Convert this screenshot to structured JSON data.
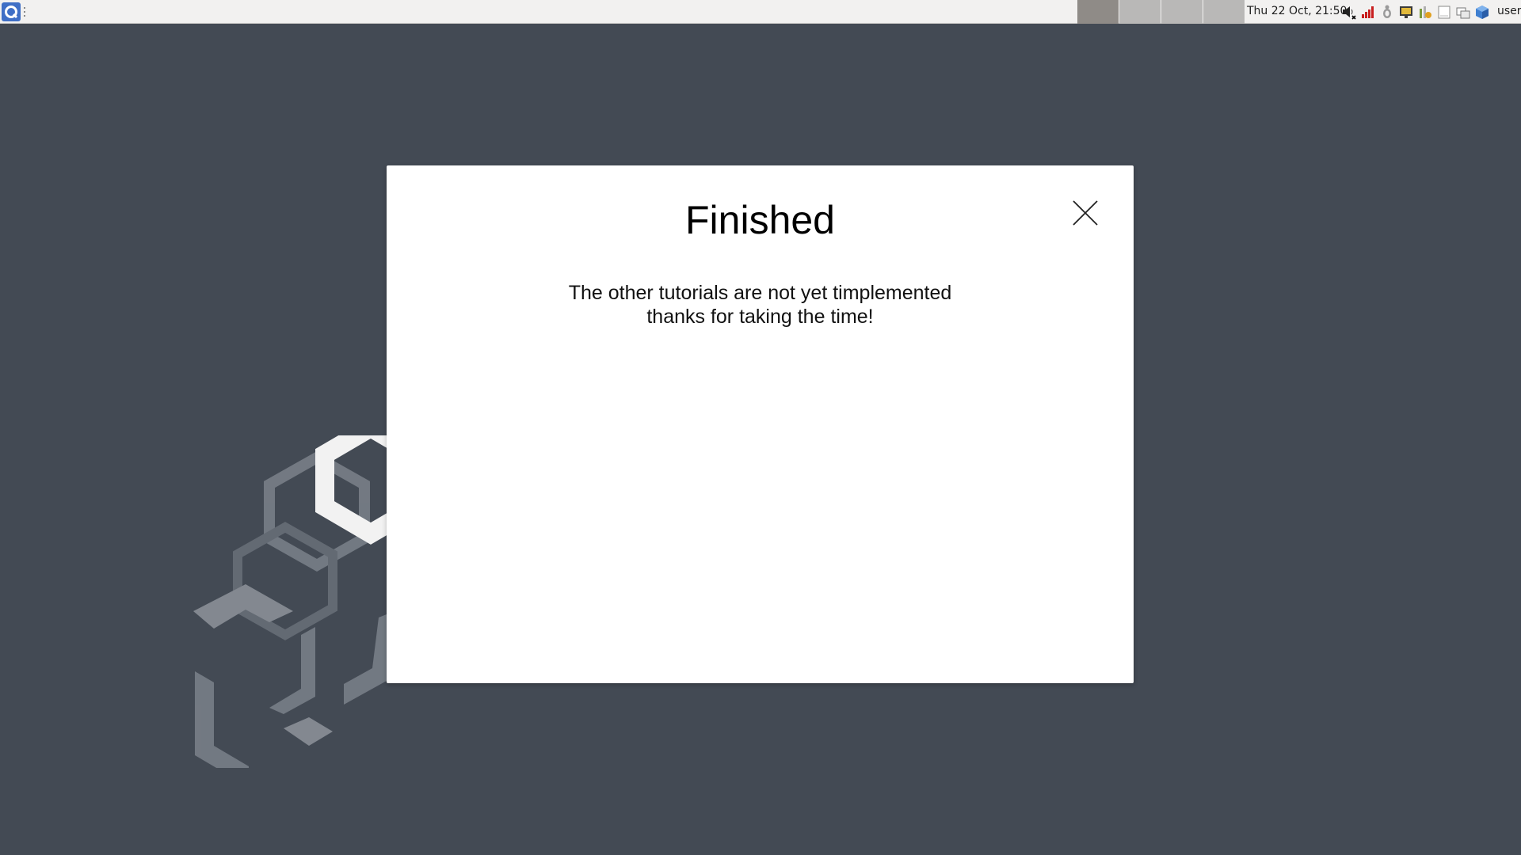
{
  "taskbar": {
    "start_icon": "app-launcher-icon",
    "workspaces": [
      {
        "id": "workspace-1",
        "active": true
      },
      {
        "id": "workspace-2",
        "active": false
      },
      {
        "id": "workspace-3",
        "active": false
      },
      {
        "id": "workspace-4",
        "active": false
      }
    ],
    "clock": "Thu 22 Oct, 21:50",
    "tray_icons": [
      "volume-muted-icon",
      "network-signal-icon",
      "hand-icon",
      "display-icon",
      "updates-icon",
      "notes-icon",
      "window-list-icon",
      "cube-icon"
    ],
    "username": "user"
  },
  "dialog": {
    "title": "Finished",
    "message_line1": "The other tutorials are not yet timplemented",
    "message_line2": "thanks for taking the time!",
    "close_icon": "close-icon"
  },
  "colors": {
    "desktop_bg": "#434a54",
    "taskbar_bg": "#f2f1f0",
    "dialog_bg": "#ffffff"
  }
}
